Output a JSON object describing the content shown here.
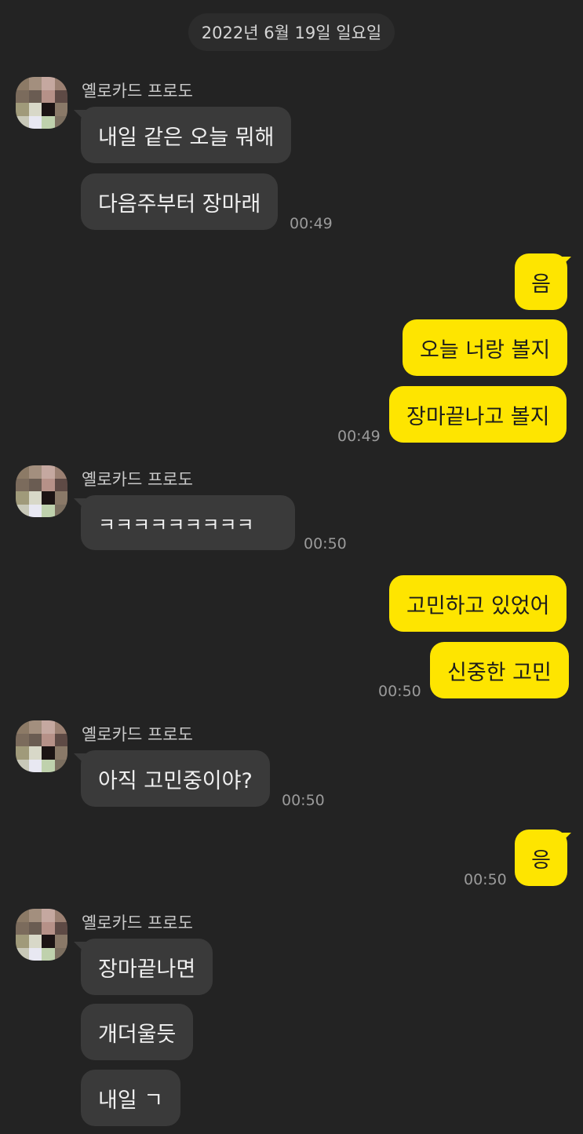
{
  "date_divider": "2022년 6월 19일 일요일",
  "sender_name": "옐로카드 프로도",
  "messages": {
    "m1": "내일 같은 오늘 뭐해",
    "m2": "다음주부터 장마래",
    "t1": "00:49",
    "m3": "음",
    "m4": "오늘 너랑 볼지",
    "m5": "장마끝나고 볼지",
    "t2": "00:49",
    "m6": "ㅋㅋㅋㅋㅋㅋㅋㅋㅋ",
    "t3": "00:50",
    "m7": "고민하고 있었어",
    "m8": "신중한 고민",
    "t4": "00:50",
    "m9": "아직 고민중이야?",
    "t5": "00:50",
    "m10": "응",
    "t6": "00:50",
    "m11": "장마끝나면",
    "m12": "개더울듯",
    "m13": "내일 ㄱ"
  },
  "colors": {
    "background": "#232323",
    "incoming_bubble": "#3a3a3a",
    "outgoing_bubble": "#fee500"
  },
  "icons": {
    "avatar": "avatar-icon"
  }
}
